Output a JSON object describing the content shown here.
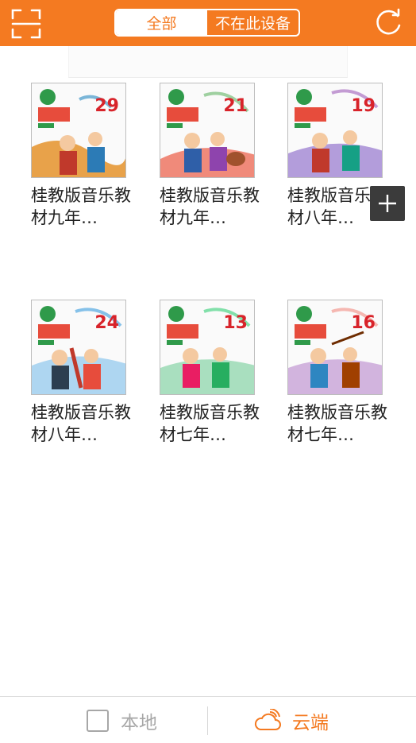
{
  "header": {
    "scan_icon": "scan-frame-icon",
    "refresh_icon": "refresh-icon",
    "tabs": [
      {
        "label": "全部",
        "active": true
      },
      {
        "label": "不在此设备",
        "active": false
      }
    ],
    "accent_color": "#f47a21"
  },
  "books": [
    {
      "title": "桂教版音乐教材九年…",
      "cover_number": "29"
    },
    {
      "title": "桂教版音乐教材九年…",
      "cover_number": "21"
    },
    {
      "title": "桂教版音乐教材八年…",
      "cover_number": "19"
    },
    {
      "title": "桂教版音乐教材八年…",
      "cover_number": "24"
    },
    {
      "title": "桂教版音乐教材七年…",
      "cover_number": "13"
    },
    {
      "title": "桂教版音乐教材七年…",
      "cover_number": "16"
    }
  ],
  "add_button": {
    "icon": "plus-icon"
  },
  "bottom_nav": {
    "local": {
      "label": "本地",
      "icon": "square-outline-icon",
      "active": false
    },
    "cloud": {
      "label": "云端",
      "icon": "cloud-icon",
      "active": true
    }
  }
}
